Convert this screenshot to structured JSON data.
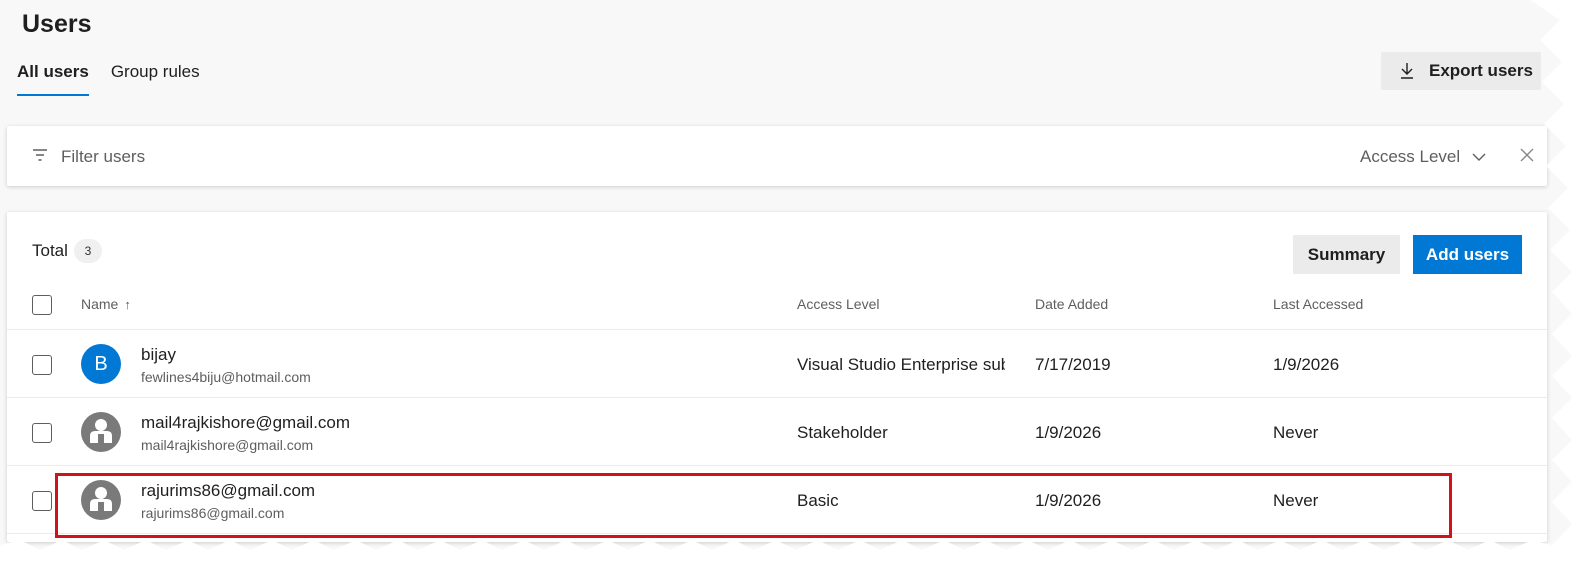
{
  "page": {
    "title": "Users"
  },
  "tabs": [
    {
      "label": "All users"
    },
    {
      "label": "Group rules"
    }
  ],
  "toolbar": {
    "export_label": "Export users"
  },
  "filter": {
    "placeholder": "Filter users",
    "access_level_label": "Access Level"
  },
  "summary": {
    "total_label": "Total",
    "total_count": "3",
    "summary_button": "Summary",
    "add_users_button": "Add users"
  },
  "columns": {
    "name": "Name",
    "sort_indicator": "↑",
    "access_level": "Access Level",
    "date_added": "Date Added",
    "last_accessed": "Last Accessed"
  },
  "users": [
    {
      "avatar_letter": "B",
      "name": "bijay",
      "email": "fewlines4biju@hotmail.com",
      "access_level": "Visual Studio Enterprise sub",
      "date_added": "7/17/2019",
      "last_accessed": "1/9/2026"
    },
    {
      "avatar_letter": "",
      "name": "mail4rajkishore@gmail.com",
      "email": "mail4rajkishore@gmail.com",
      "access_level": "Stakeholder",
      "date_added": "1/9/2026",
      "last_accessed": "Never"
    },
    {
      "avatar_letter": "",
      "name": "rajurims86@gmail.com",
      "email": "rajurims86@gmail.com",
      "access_level": "Basic",
      "date_added": "1/9/2026",
      "last_accessed": "Never"
    }
  ],
  "colors": {
    "accent": "#0078d4",
    "highlight_box": "#d1121b",
    "avatar_default": "#7a7a7a"
  },
  "icons": {
    "export": "download-icon",
    "filter": "filter-icon",
    "dropdown": "chevron-down-icon",
    "close": "close-icon",
    "avatar_placeholder": "person-icon"
  }
}
